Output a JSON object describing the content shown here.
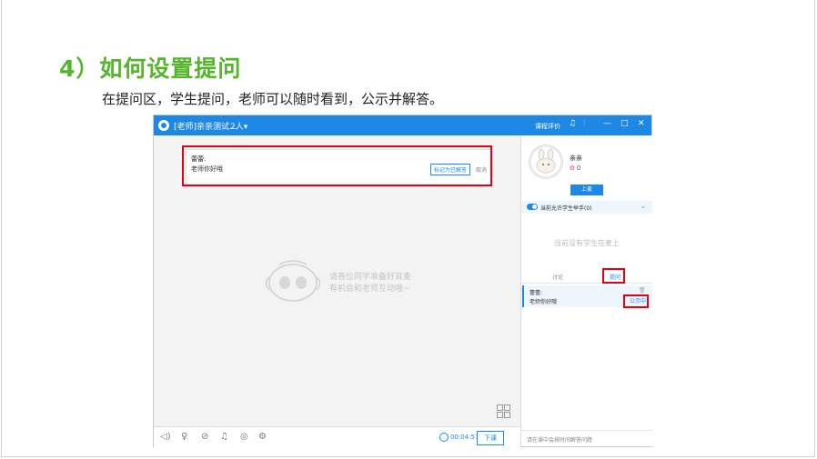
{
  "slide": {
    "title": "4）如何设置提问",
    "subtitle": "在提问区，学生提问，老师可以随时看到，公示并解答。"
  },
  "app": {
    "window_title": "[老师]亲亲测试...",
    "people_count": "2人▾",
    "rate_course": "课程评价",
    "question_card": {
      "student_name": "蕾蕾:",
      "message": "老师你好哦",
      "mark_answered": "标记为已解答",
      "cancel": "取消"
    },
    "empty_hint_line1": "请各位同学准备好耳麦",
    "empty_hint_line2": "有机会和老师互动哦~",
    "bottom": {
      "timer": "00:04:57",
      "end_class": "下课"
    },
    "sidebar": {
      "user_name": "亲亲",
      "flowers": "0",
      "go_on_stage": "上麦",
      "allow_raise_hand": "当前允许学生举手(0)",
      "no_student_on_stage": "当前没有学生在麦上",
      "tab_discussion": "讨论",
      "tab_question": "提问",
      "question_item": {
        "student_name": "蕾蕾:",
        "message": "老师你好哦",
        "publish": "公示中"
      },
      "input_hint": "请在课中会按时间解答问题"
    }
  },
  "colors": {
    "accent": "#1e88e5",
    "title_green": "#55b52d",
    "highlight_red": "#e60012"
  }
}
